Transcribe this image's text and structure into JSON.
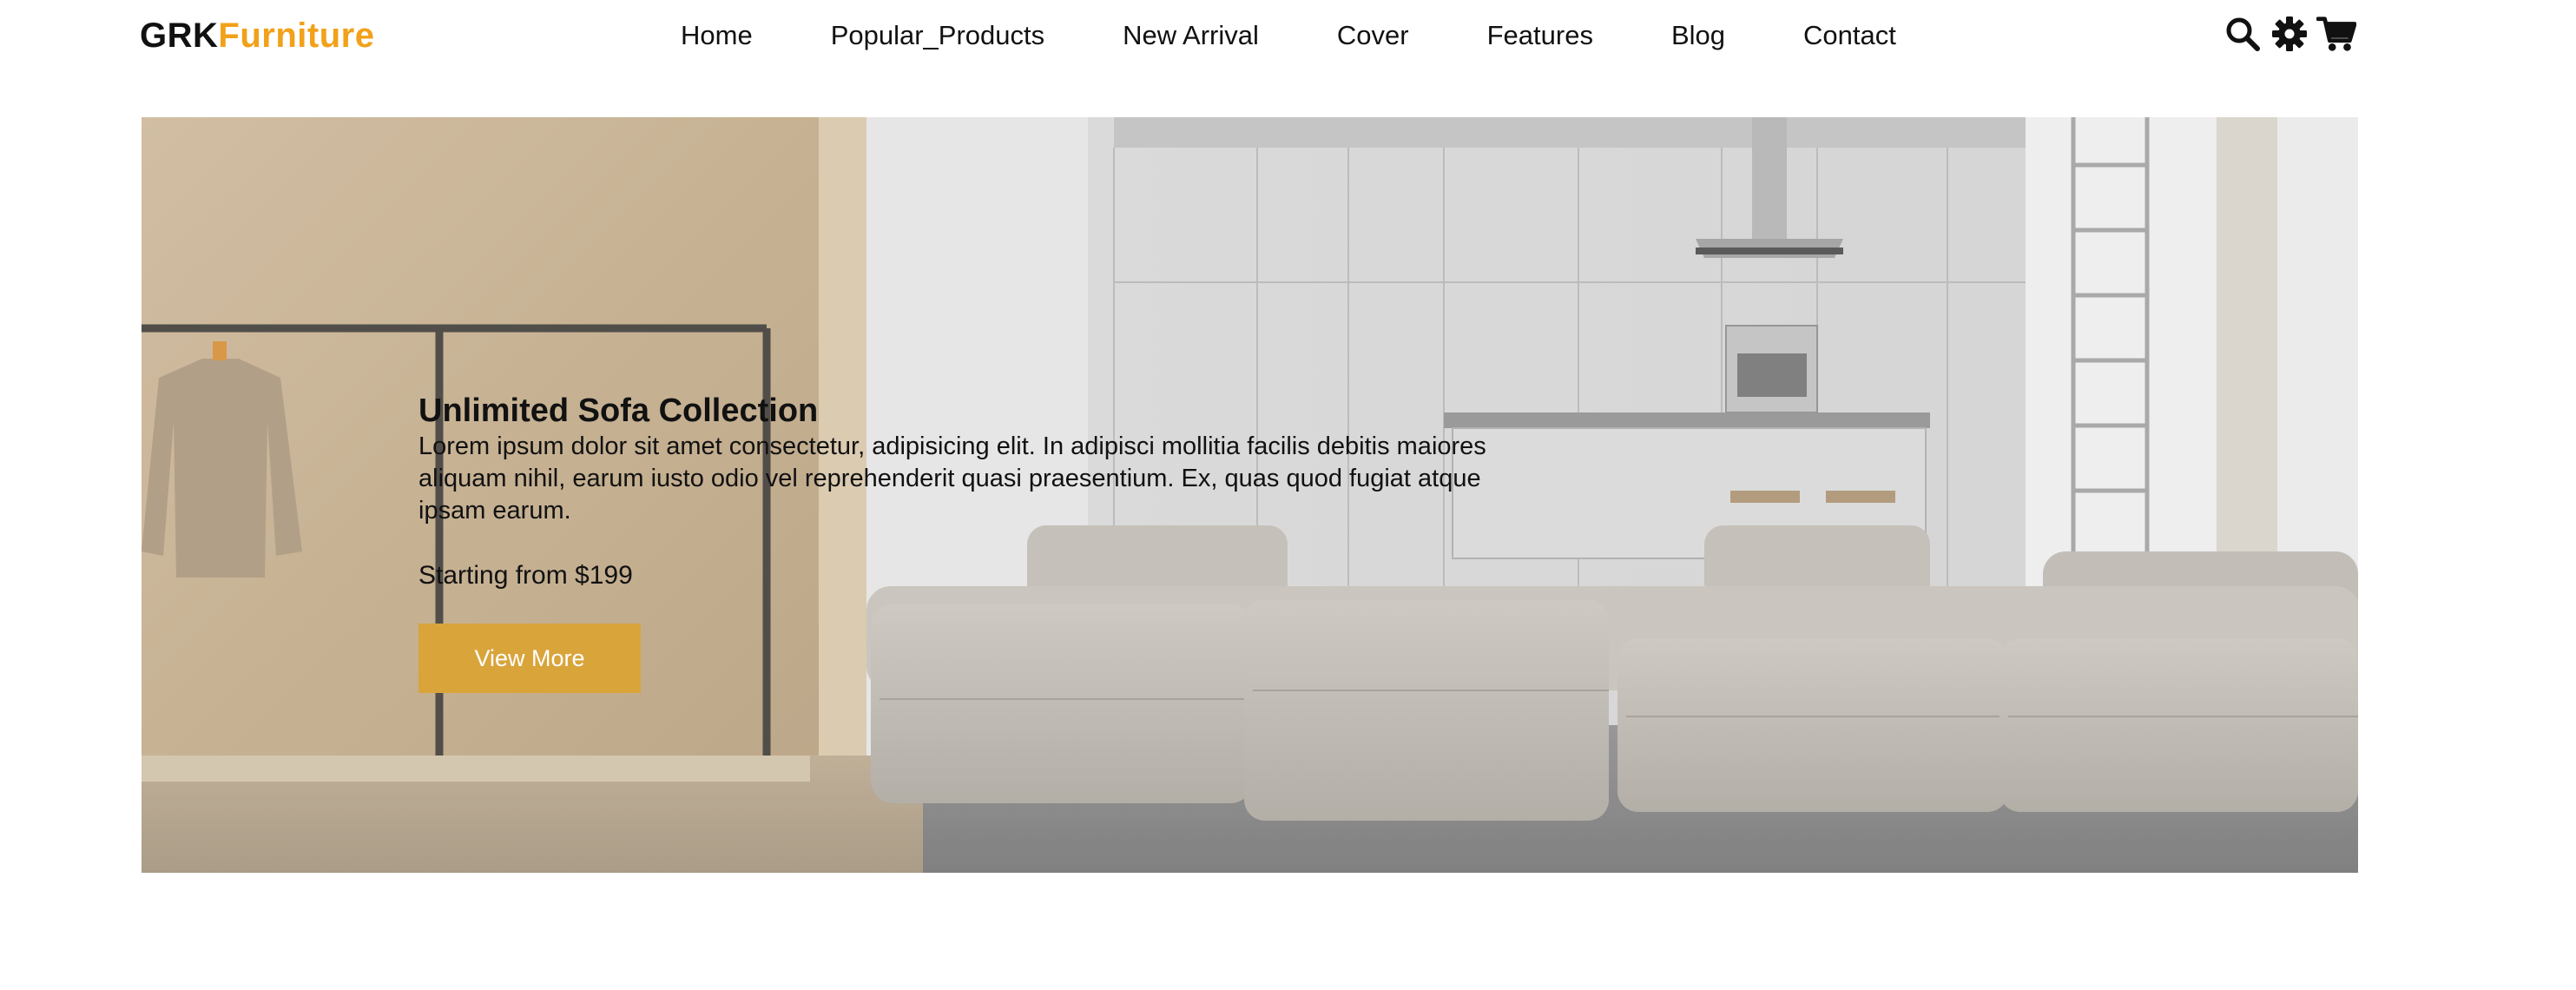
{
  "header": {
    "logo_part1": "GRK",
    "logo_part2": "Furniture",
    "nav": [
      "Home",
      "Popular_Products",
      "New Arrival",
      "Cover",
      "Features",
      "Blog",
      "Contact"
    ],
    "icons": [
      "search-icon",
      "gear-icon",
      "cart-icon"
    ]
  },
  "hero": {
    "title": "Unlimited Sofa Collection",
    "description": "Lorem ipsum dolor sit amet consectetur, adipisicing elit. In adipisci mollitia facilis debitis maiores aliquam nihil, earum iusto odio vel reprehenderit quasi praesentium. Ex, quas quod fugiat atque ipsam earum.",
    "price": "Starting from $199",
    "button_label": "View More"
  },
  "colors": {
    "brand_accent": "#f2a11a",
    "button": "#d9a43a"
  }
}
